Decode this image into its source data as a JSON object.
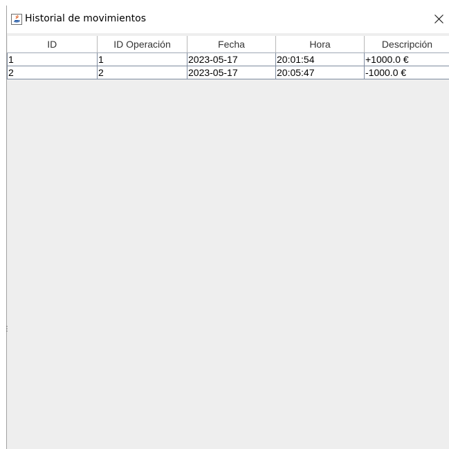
{
  "window": {
    "title": "Historial de movimientos",
    "icon": "java-icon",
    "close_icon": "close-icon"
  },
  "table": {
    "columns": [
      "ID",
      "ID Operación",
      "Fecha",
      "Hora",
      "Descripción"
    ],
    "rows": [
      [
        "1",
        "1",
        "2023-05-17",
        "20:01:54",
        "+1000.0 €"
      ],
      [
        "2",
        "2",
        "2023-05-17",
        "20:05:47",
        "-1000.0 €"
      ]
    ]
  },
  "colors": {
    "content_bg": "#eeeeee",
    "grid_line": "#7d8a9e",
    "header_bg": "#ffffff"
  }
}
